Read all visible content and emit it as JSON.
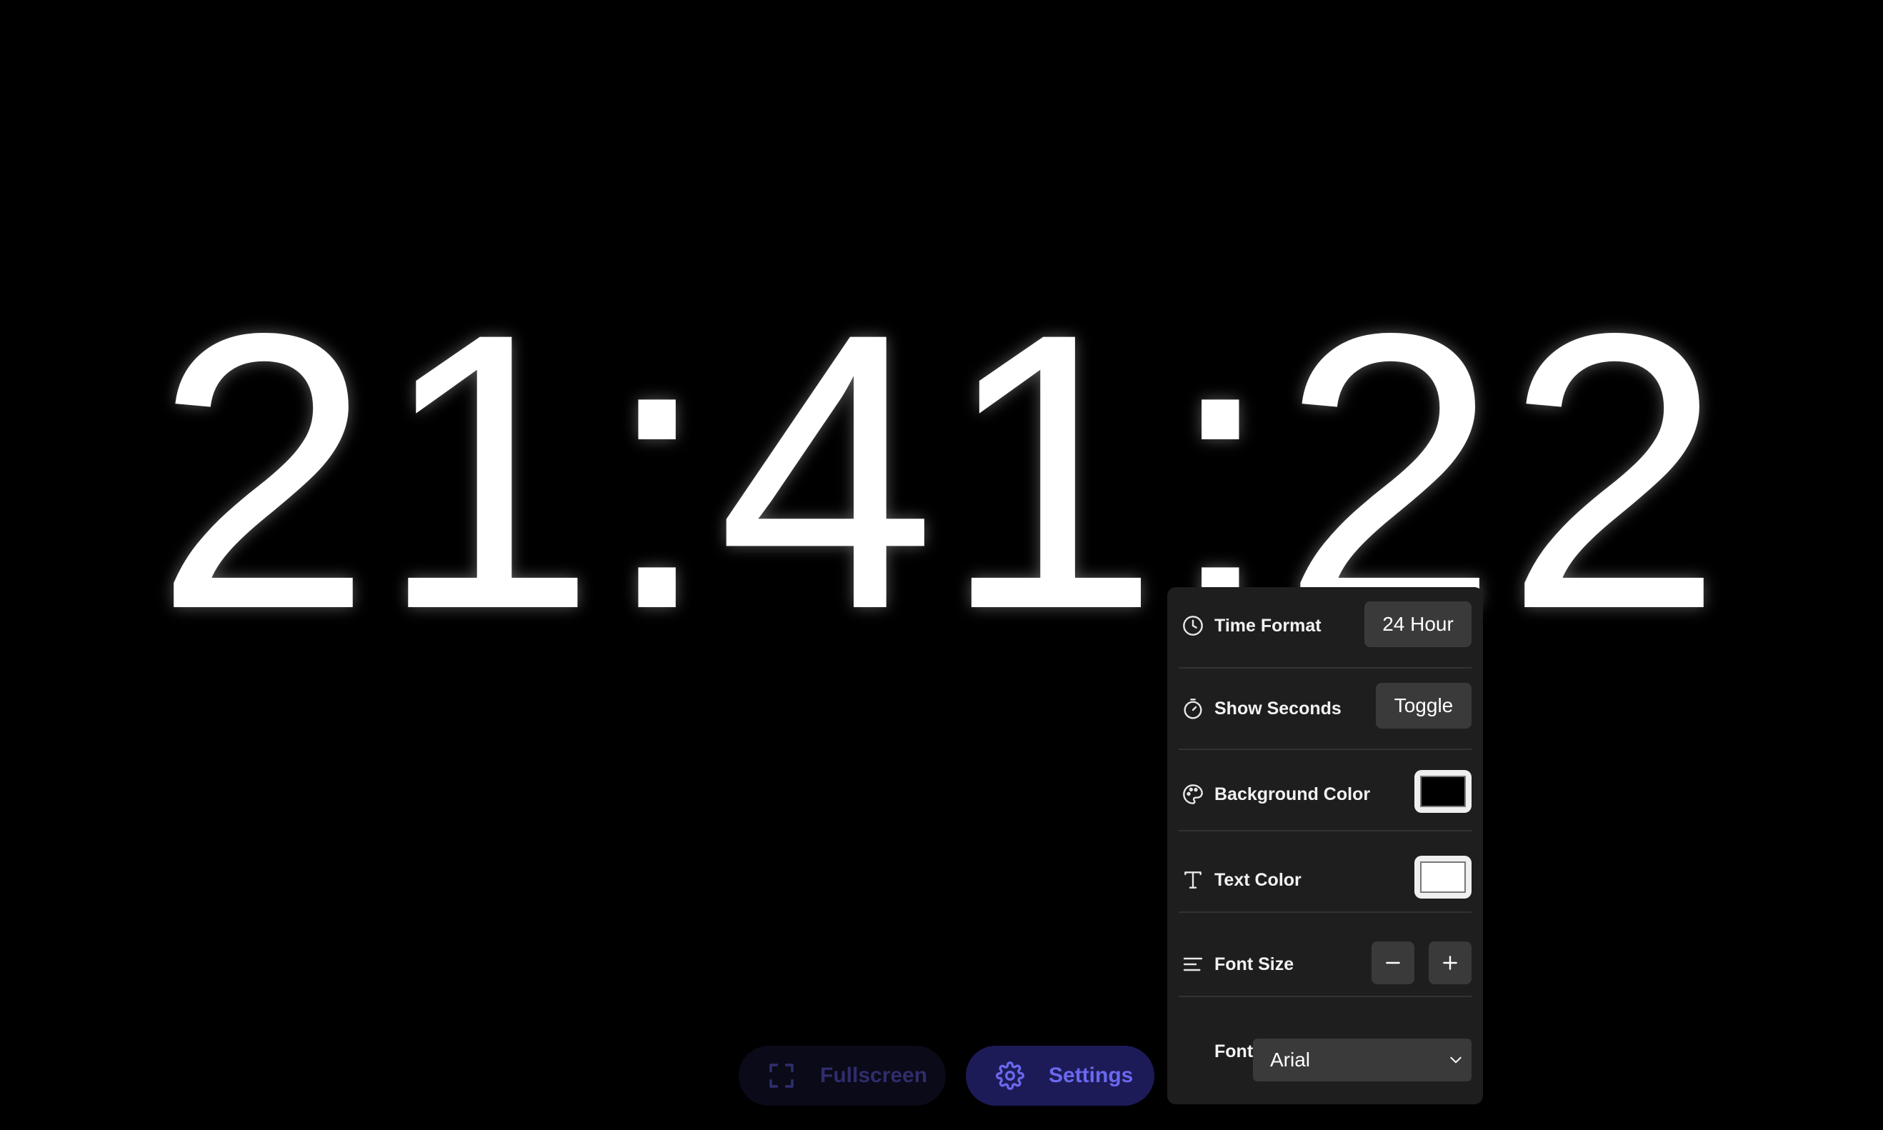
{
  "clock": {
    "time": "21:41:22"
  },
  "controls": {
    "fullscreen_label": "Fullscreen",
    "settings_label": "Settings",
    "fullscreen_icon": "expand-corners-icon",
    "settings_icon": "gear-icon"
  },
  "settings": {
    "time_format": {
      "label": "Time Format",
      "value": "24 Hour",
      "icon": "clock-icon"
    },
    "show_seconds": {
      "label": "Show Seconds",
      "button": "Toggle",
      "icon": "stopwatch-icon"
    },
    "background_color": {
      "label": "Background Color",
      "value": "#000000",
      "icon": "palette-icon"
    },
    "text_color": {
      "label": "Text Color",
      "value": "#ffffff",
      "icon": "text-type-icon"
    },
    "font_size": {
      "label": "Font Size",
      "decrease_icon": "minus-icon",
      "increase_icon": "plus-icon",
      "icon": "text-align-icon"
    },
    "font": {
      "label": "Font",
      "selected": "Arial"
    }
  },
  "colors": {
    "accent": "#6b68ef",
    "accent_bg": "#1c1b57",
    "panel_bg": "#1e1e1e",
    "page_bg": "#000000",
    "clock_text": "#ffffff"
  }
}
